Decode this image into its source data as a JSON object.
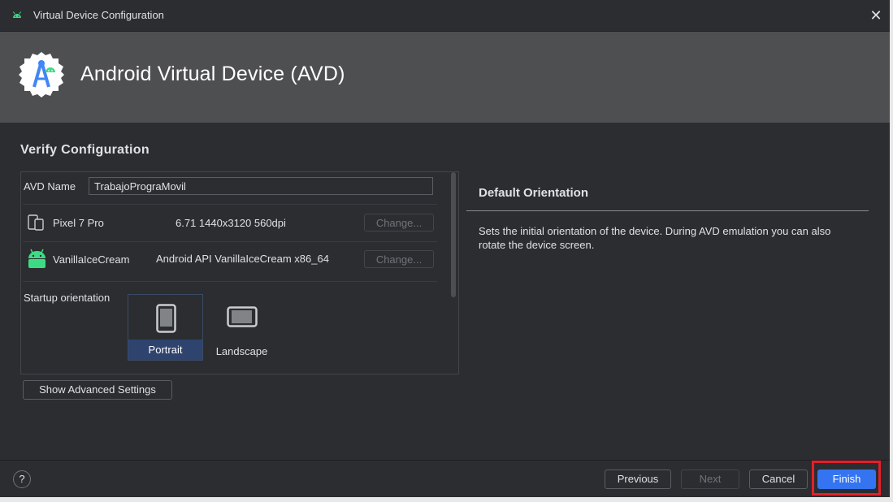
{
  "window": {
    "title": "Virtual Device Configuration",
    "close_icon": "close-icon"
  },
  "header": {
    "title": "Android Virtual Device (AVD)",
    "logo_icon": "android-studio-logo"
  },
  "section": {
    "title": "Verify Configuration"
  },
  "form": {
    "avd_name_label": "AVD Name",
    "avd_name_value": "TrabajoPrograMovil",
    "device": {
      "name": "Pixel 7 Pro",
      "spec": "6.71 1440x3120 560dpi",
      "change_label": "Change...",
      "icon": "phone-tablet-icon"
    },
    "system_image": {
      "name": "VanillaIceCream",
      "spec": "Android API VanillaIceCream x86_64",
      "change_label": "Change...",
      "icon": "android-icon"
    },
    "startup_orientation_label": "Startup orientation",
    "orientations": [
      {
        "label": "Portrait",
        "selected": true,
        "icon": "portrait-phone-icon"
      },
      {
        "label": "Landscape",
        "selected": false,
        "icon": "landscape-phone-icon"
      }
    ],
    "advanced_button": "Show Advanced Settings"
  },
  "info": {
    "title": "Default Orientation",
    "text": "Sets the initial orientation of the device. During AVD emulation you can also rotate the device screen."
  },
  "footer": {
    "help_label": "?",
    "previous": "Previous",
    "next": "Next",
    "cancel": "Cancel",
    "finish": "Finish"
  },
  "colors": {
    "accent": "#3574f0",
    "highlight": "#e3202a",
    "android_green": "#3ddc84",
    "header_bg": "#4e4f51",
    "selected_tile": "#2e436e"
  }
}
